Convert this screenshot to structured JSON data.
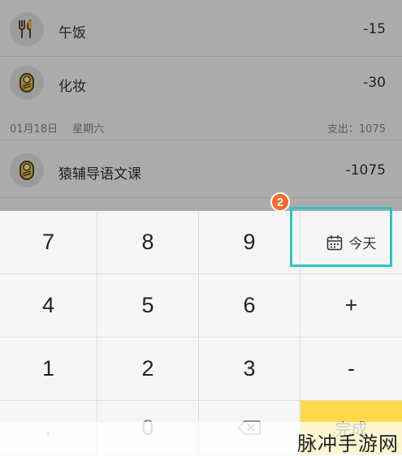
{
  "transactions_top": [
    {
      "label": "午饭",
      "amount": "-15",
      "icon": "fork-knife-icon"
    },
    {
      "label": "化妆",
      "amount": "-30",
      "icon": "baby-icon"
    }
  ],
  "date_header": {
    "date": "01月18日",
    "weekday": "星期六",
    "summary": "支出：1075"
  },
  "transactions_bottom": [
    {
      "label": "猿辅导语文课",
      "amount": "-1075",
      "icon": "baby-icon"
    }
  ],
  "keypad": {
    "row1": [
      "7",
      "8",
      "9"
    ],
    "today_label": "今天",
    "row2": [
      "4",
      "5",
      "6",
      "+"
    ],
    "row3": [
      "1",
      "2",
      "3",
      "-"
    ],
    "row4": [
      ".",
      "0"
    ],
    "done_label": "完成"
  },
  "annotation": {
    "step_badge": "2"
  },
  "watermark": "脉冲手游网",
  "colors": {
    "accent": "#ffda4d",
    "highlight": "#2ec4c8",
    "badge": "#f26b2b"
  }
}
